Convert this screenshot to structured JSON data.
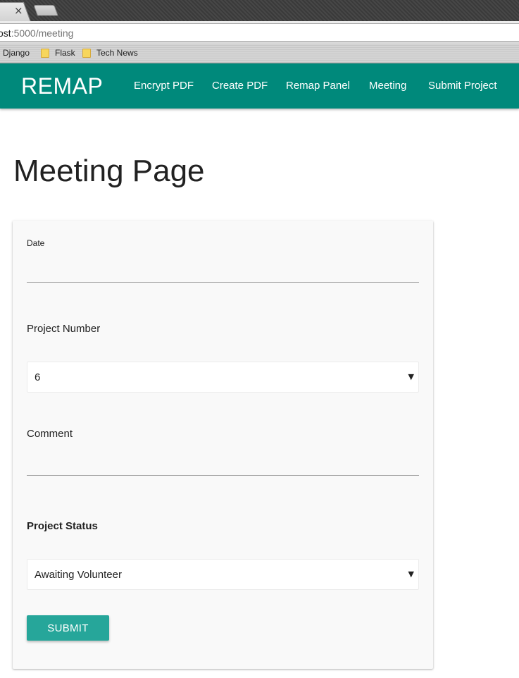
{
  "browser": {
    "tab_close_glyph": "×",
    "url_host": "ost",
    "url_path": ":5000/meeting",
    "bookmarks": [
      {
        "label": "Django",
        "icon": "folder-icon"
      },
      {
        "label": "Flask",
        "icon": "folder-icon"
      },
      {
        "label": "Tech News",
        "icon": "folder-icon"
      }
    ]
  },
  "navbar": {
    "brand": "REMAP",
    "links": [
      {
        "label": "Encrypt PDF"
      },
      {
        "label": "Create PDF"
      },
      {
        "label": "Remap Panel"
      },
      {
        "label": "Meeting"
      },
      {
        "label": "Submit Project"
      }
    ],
    "color": "#00897b"
  },
  "page": {
    "title": "Meeting Page"
  },
  "form": {
    "date": {
      "label": "Date",
      "value": ""
    },
    "project_number": {
      "label": "Project Number",
      "selected": "6"
    },
    "comment": {
      "label": "Comment",
      "value": ""
    },
    "project_status": {
      "label": "Project Status",
      "selected": "Awaiting Volunteer"
    },
    "submit_label": "SUBMIT",
    "button_color": "#26a69a"
  },
  "icons": {
    "select_caret": "▼"
  }
}
